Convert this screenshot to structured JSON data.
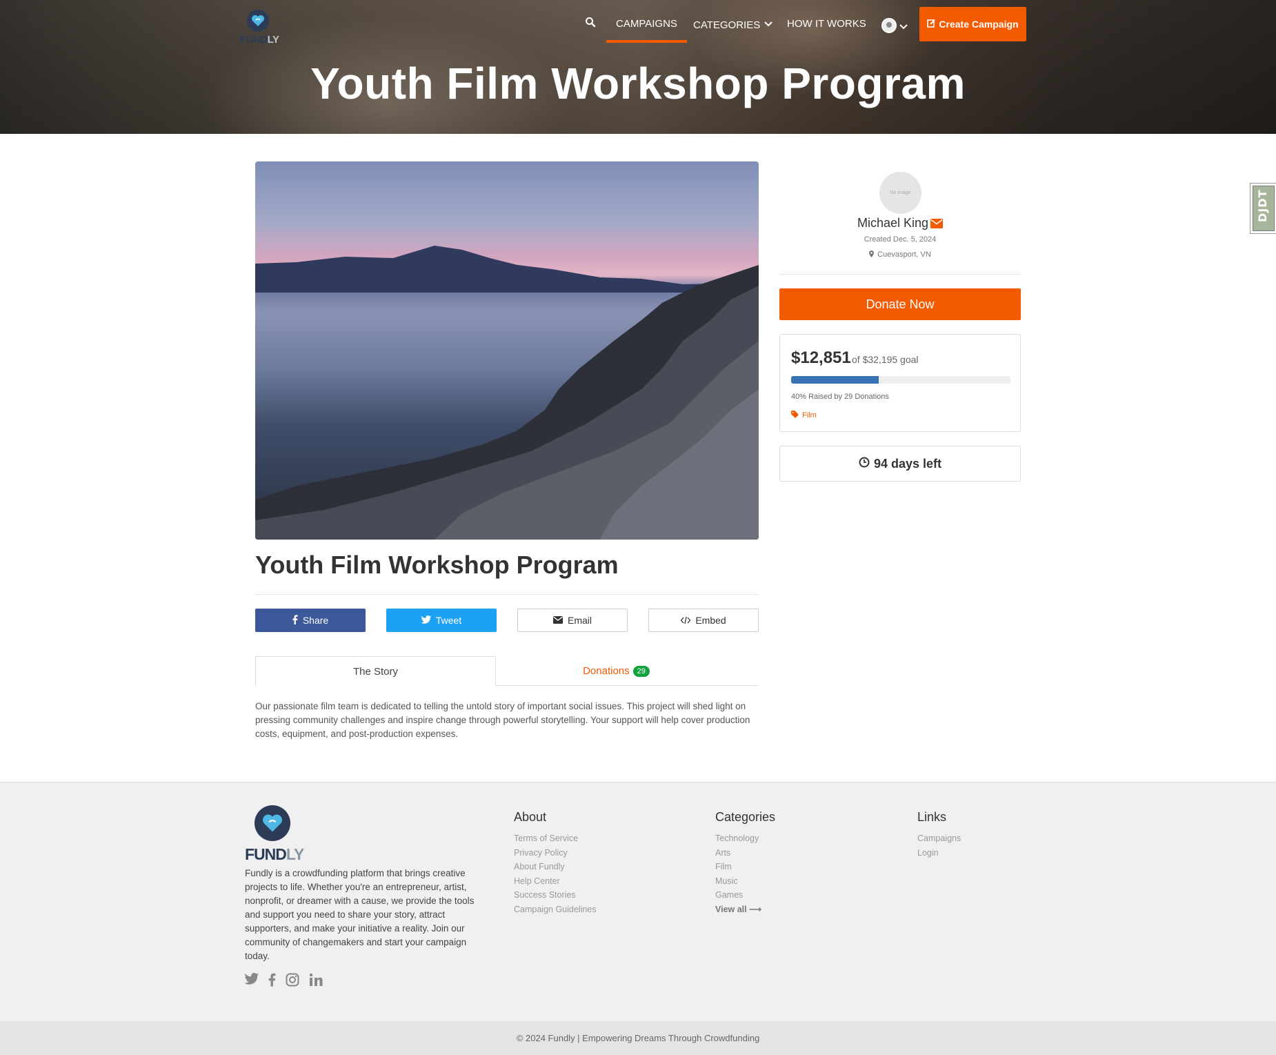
{
  "brand": {
    "logo_word_a": "FUND",
    "logo_word_b": "LY",
    "accent": "#f45a00",
    "dark": "#2d3c56"
  },
  "nav": {
    "search_icon": "search-icon",
    "items": [
      {
        "label": "CAMPAIGNS",
        "active": true
      },
      {
        "label": "CATEGORIES"
      },
      {
        "label": "HOW IT WORKS"
      }
    ],
    "create_label": "Create Campaign"
  },
  "hero": {
    "title": "Youth Film Workshop Program"
  },
  "campaign": {
    "title": "Youth Film Workshop Program",
    "share": {
      "facebook": "Share",
      "twitter": "Tweet",
      "email": "Email",
      "embed": "Embed"
    },
    "tabs": {
      "story": "The Story",
      "donations": "Donations",
      "donations_count": "29"
    },
    "story": "Our passionate film team is dedicated to telling the untold story of important social issues. This project will shed light on pressing community challenges and inspire change through powerful storytelling. Your support will help cover production costs, equipment, and post-production expenses."
  },
  "creator": {
    "avatar_text": "No Image",
    "name": "Michael King",
    "created": "Created Dec. 5, 2024",
    "location": "Cuevasport, VN"
  },
  "donate_label": "Donate Now",
  "funding": {
    "raised": "$12,851",
    "goal_text": "of $32,195 goal",
    "progress_fraction": 0.4,
    "stats": "40% Raised by 29 Donations",
    "category": "Film",
    "progress_color": "#3773b4"
  },
  "days_left": "94 days left",
  "debug_toolbar": "DJDT",
  "footer": {
    "logo_word_a": "FUND",
    "logo_word_b": "LY",
    "about_text": "Fundly is a crowdfunding platform that brings creative projects to life. Whether you're an entrepreneur, artist, nonprofit, or dreamer with a cause, we provide the tools and support you need to share your story, attract supporters, and make your initiative a reality. Join our community of changemakers and start your campaign today.",
    "social": [
      "twitter-icon",
      "facebook-icon",
      "instagram-icon",
      "linkedin-icon"
    ],
    "columns": [
      {
        "title": "About",
        "links": [
          "Terms of Service",
          "Privacy Policy",
          "About Fundly",
          "Help Center",
          "Success Stories",
          "Campaign Guidelines"
        ]
      },
      {
        "title": "Categories",
        "links": [
          "Technology",
          "Arts",
          "Film",
          "Music",
          "Games"
        ],
        "view_all": "View all"
      },
      {
        "title": "Links",
        "links": [
          "Campaigns",
          "Login"
        ]
      }
    ],
    "copyright": "© 2024 Fundly | Empowering Dreams Through Crowdfunding"
  }
}
